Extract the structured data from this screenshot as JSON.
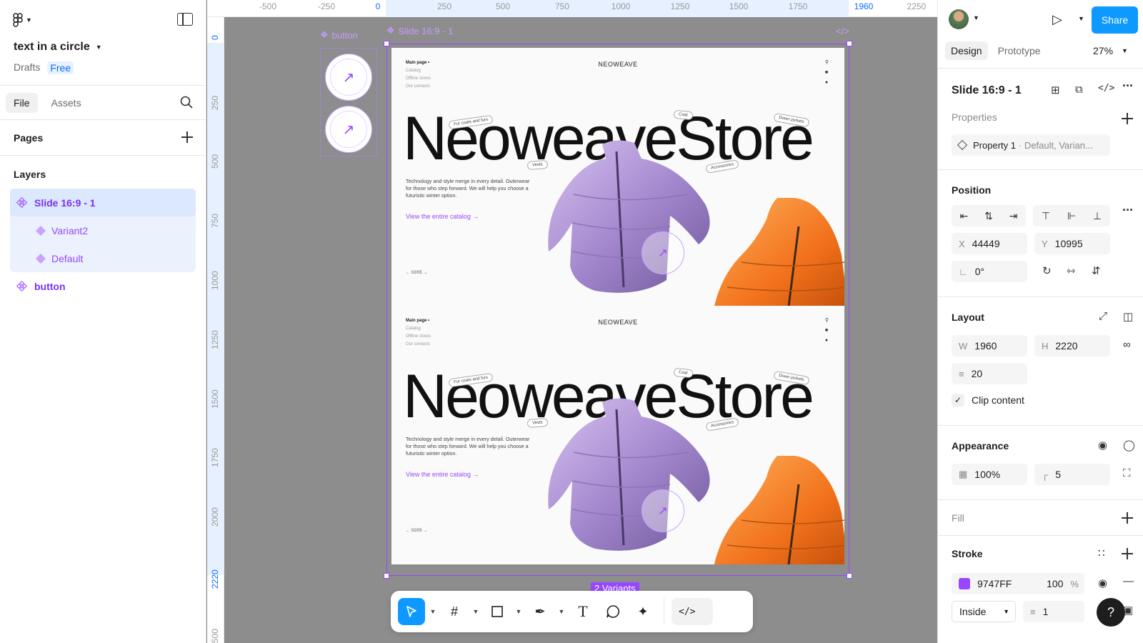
{
  "file": {
    "title": "text in a circle",
    "drafts": "Drafts",
    "plan": "Free"
  },
  "left_tabs": {
    "file": "File",
    "assets": "Assets"
  },
  "pages": {
    "title": "Pages"
  },
  "layers": {
    "title": "Layers",
    "items": [
      {
        "label": "Slide 16:9 - 1",
        "kind": "component-set"
      },
      {
        "label": "Variant2",
        "kind": "variant"
      },
      {
        "label": "Default",
        "kind": "variant"
      },
      {
        "label": "button",
        "kind": "component-set"
      }
    ]
  },
  "ruler_top": [
    {
      "label": "-500",
      "blue": false
    },
    {
      "label": "-250",
      "blue": false
    },
    {
      "label": "0",
      "blue": true
    },
    {
      "label": "250",
      "blue": false
    },
    {
      "label": "500",
      "blue": false
    },
    {
      "label": "750",
      "blue": false
    },
    {
      "label": "1000",
      "blue": false
    },
    {
      "label": "1250",
      "blue": false
    },
    {
      "label": "1500",
      "blue": false
    },
    {
      "label": "1750",
      "blue": false
    },
    {
      "label": "1960",
      "blue": true
    },
    {
      "label": "2250",
      "blue": false
    }
  ],
  "ruler_left": [
    {
      "label": "0",
      "blue": true
    },
    {
      "label": "250",
      "blue": false
    },
    {
      "label": "500",
      "blue": false
    },
    {
      "label": "750",
      "blue": false
    },
    {
      "label": "1000",
      "blue": false
    },
    {
      "label": "1250",
      "blue": false
    },
    {
      "label": "1500",
      "blue": false
    },
    {
      "label": "1750",
      "blue": false
    },
    {
      "label": "2000",
      "blue": false
    },
    {
      "label": "2220",
      "blue": true
    },
    {
      "label": "500",
      "blue": false
    }
  ],
  "canvas": {
    "button_label": "button",
    "slide_frame_label": "Slide 16:9 - 1",
    "variants_tag": "2 Variants",
    "code_glyph": "</>",
    "circle_arrow": "↗"
  },
  "slide": {
    "nav": [
      "Main page •",
      "Catalog",
      "Offline stores",
      "Our contacts"
    ],
    "brand": "NEOWEAVE",
    "title": "NeoweaveStore",
    "description": "Technology and style merge in every detail. Outerwear for those who step forward. We will help you choose a futuristic winter option.",
    "link": "View the entire catalog →",
    "pager_current": "02",
    "pager_total": "05",
    "tags": [
      "Fur coats and furs",
      "Coat",
      "Down jackets",
      "Vests",
      "Accessories"
    ]
  },
  "toolbar": {
    "code": "</>"
  },
  "right": {
    "share": "Share",
    "tabs": {
      "design": "Design",
      "prototype": "Prototype"
    },
    "zoom": "27%",
    "selection_name": "Slide 16:9 - 1",
    "properties": {
      "title": "Properties",
      "property": "Property 1",
      "values": "· Default, Varian..."
    },
    "position": {
      "title": "Position",
      "x_label": "X",
      "x": "44449",
      "y_label": "Y",
      "y": "10995",
      "rotation": "0°"
    },
    "layout": {
      "title": "Layout",
      "w_label": "W",
      "w": "1960",
      "h_label": "H",
      "h": "2220",
      "gap": "20",
      "clip": "Clip content"
    },
    "appearance": {
      "title": "Appearance",
      "opacity": "100%",
      "radius": "5"
    },
    "fill": {
      "title": "Fill"
    },
    "stroke": {
      "title": "Stroke",
      "color": "9747FF",
      "opacity": "100",
      "pct": "%",
      "position": "Inside",
      "width": "1"
    }
  },
  "colors": {
    "accent": "#0d99ff",
    "component": "#9747ff",
    "canvas": "#8d8d8d"
  },
  "help": "?"
}
